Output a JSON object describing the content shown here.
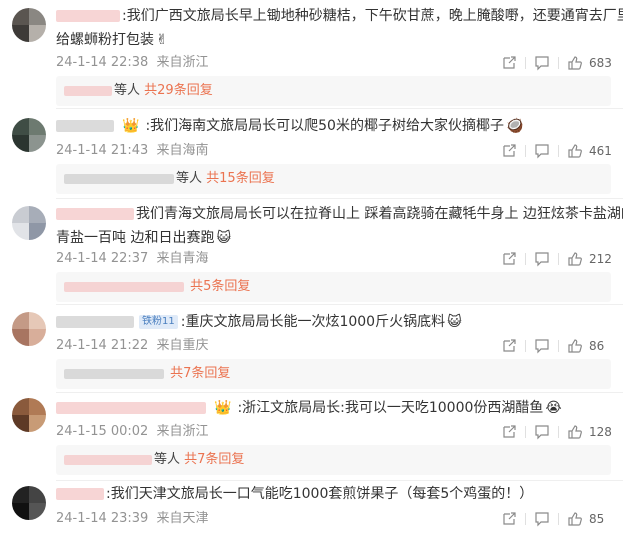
{
  "comments": [
    {
      "text_l1": ":我们广西文旅局长早上锄地种砂糖桔，下午砍甘蔗，晚上腌酸嘢，还要通宵去厂里",
      "text_l2": "给螺蛳粉打包装",
      "emoji": "✌",
      "time": "24-1-14 22:38",
      "location": "来自浙江",
      "likes": "683",
      "reply_people": "等人",
      "reply_count": "共29条回复",
      "avatar_colors": [
        "#5a5550",
        "#8a8782",
        "#3d3a37",
        "#b5b0aa"
      ]
    },
    {
      "badge_crown": "👑",
      "text_l1": ":我们海南文旅局局长可以爬50米的椰子树给大家伙摘椰子",
      "emoji": "🥥",
      "time": "24-1-14 21:43",
      "location": "来自海南",
      "likes": "461",
      "reply_people": "等人",
      "reply_count": "共15条回复",
      "avatar_colors": [
        "#3f4d45",
        "#6d7a70",
        "#2b3530",
        "#8c948f"
      ]
    },
    {
      "text_l1": "我们青海文旅局局长可以在拉脊山上 踩着高跷骑在藏牦牛身上 边狂炫茶卡盐湖的",
      "text_l2": "青盐一百吨 边和日出赛跑",
      "emoji": "😺",
      "time": "24-1-14 22:37",
      "location": "来自青海",
      "likes": "212",
      "reply_count": "共5条回复",
      "avatar_colors": [
        "#c9ccd2",
        "#a7adb8",
        "#e1e3e7",
        "#8f97a6"
      ]
    },
    {
      "badge_fan": "铁粉11",
      "text_l1": ":重庆文旅局局长能一次炫1000斤火锅底料",
      "emoji": "😺",
      "time": "24-1-14 21:22",
      "location": "来自重庆",
      "likes": "86",
      "reply_count": "共7条回复",
      "avatar_colors": [
        "#c49a86",
        "#e6c8b7",
        "#a87561",
        "#d8ae9a"
      ]
    },
    {
      "badge_crown": "👑",
      "text_l1": ":浙江文旅局局长:我可以一天吃10000份西湖醋鱼",
      "emoji": "😭",
      "time": "24-1-15 00:02",
      "location": "来自浙江",
      "likes": "128",
      "reply_people": "等人",
      "reply_count": "共7条回复",
      "avatar_colors": [
        "#8a5a3c",
        "#b07a55",
        "#5e3a26",
        "#c89b76"
      ]
    },
    {
      "text_l1": ":我们天津文旅局长一口气能吃1000套煎饼果子（每套5个鸡蛋的！）",
      "time": "24-1-14 23:39",
      "location": "来自天津",
      "likes": "85",
      "avatar_colors": [
        "#222222",
        "#444444",
        "#111111",
        "#555555"
      ]
    }
  ]
}
